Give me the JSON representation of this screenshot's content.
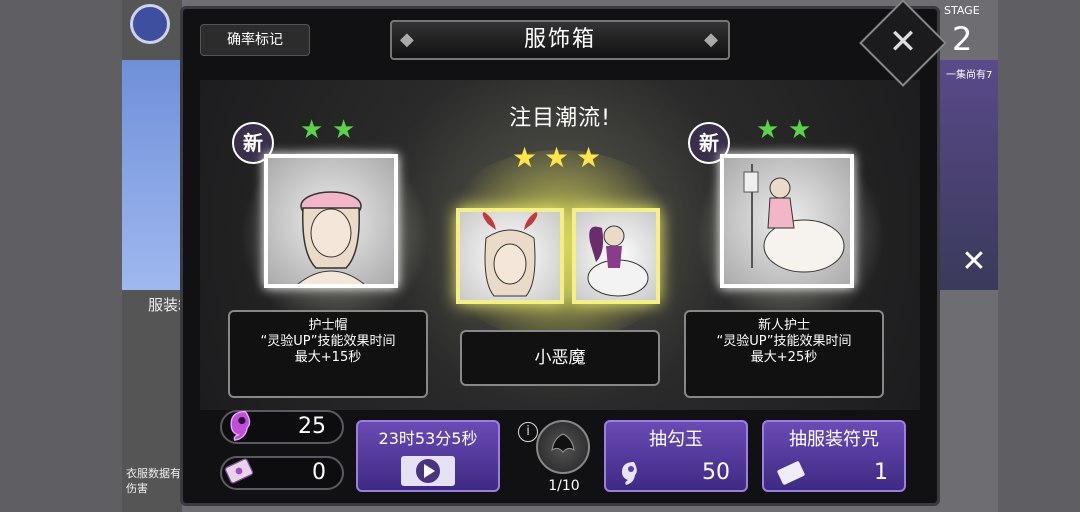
{
  "background": {
    "side_label": "服装箱",
    "bottom_text": "衣服数据有伤害",
    "stage_label": "STAGE",
    "stage_number": "2",
    "stage_note": "一集尚有7"
  },
  "modal": {
    "probability_button": "确率标记",
    "title": "服饰箱",
    "featured_heading": "注目潮流!",
    "new_badge": "新",
    "left_item": {
      "desc_line1": "护士帽",
      "desc_line2": "“灵验UP”技能效果时间",
      "desc_line3": "最大+15秒"
    },
    "center_item": {
      "name": "小恶魔"
    },
    "right_item": {
      "desc_line1": "新人护士",
      "desc_line2": "“灵验UP”技能效果时间",
      "desc_line3": "最大+25秒"
    },
    "magatama_count": "25",
    "charm_count": "0",
    "timer_label": "23时53分5秒",
    "info_symbol": "i",
    "draw_progress": "1/10",
    "draw_magatama_label": "抽勾玉",
    "draw_magatama_cost": "50",
    "draw_charm_label": "抽服装符咒",
    "draw_charm_cost": "1"
  },
  "colors": {
    "star_green": "#5bd24a",
    "star_yellow": "#ffe54a",
    "button_purple": "#5a3ea6"
  }
}
